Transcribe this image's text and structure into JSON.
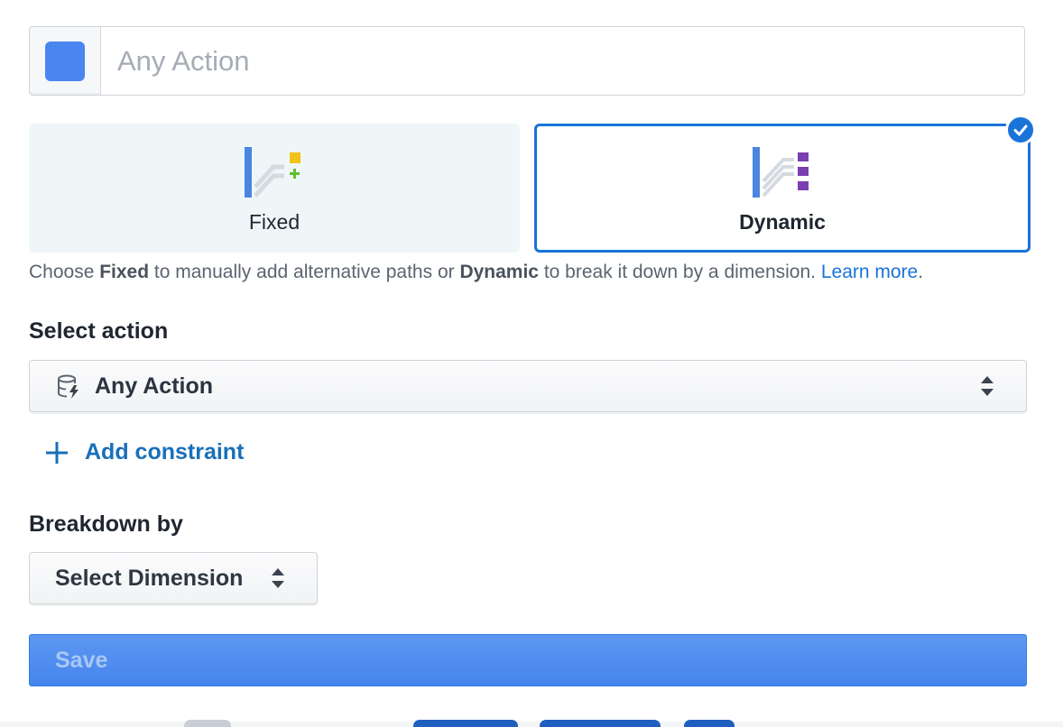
{
  "name_field": {
    "placeholder": "Any Action",
    "color": "#4a86f0"
  },
  "modes": {
    "fixed": {
      "label": "Fixed"
    },
    "dynamic": {
      "label": "Dynamic",
      "selected": true
    }
  },
  "help": {
    "part1": "Choose ",
    "fixed_word": "Fixed",
    "part2": " to manually add alternative paths or ",
    "dynamic_word": "Dynamic",
    "part3": " to break it down by a dimension. ",
    "learn_more": "Learn more",
    "period": "."
  },
  "select_action": {
    "label": "Select action",
    "value": "Any Action"
  },
  "add_constraint": {
    "label": "Add constraint"
  },
  "breakdown": {
    "label": "Breakdown by",
    "value": "Select Dimension"
  },
  "save": {
    "label": "Save",
    "disabled": true
  },
  "colors": {
    "accent": "#1a73d9",
    "link": "#1a6fb8",
    "save_bg": "#4a89ee",
    "fixed_card_bg": "#eef6f8"
  }
}
